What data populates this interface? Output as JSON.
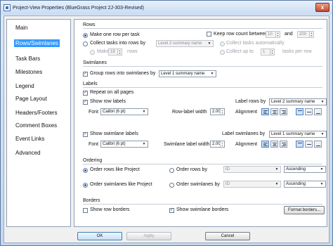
{
  "window": {
    "title": "Project-View Properties (BlueGrass Project 2J-303-Revised)",
    "close_label": "x"
  },
  "nav": {
    "items": [
      "Main",
      "Rows/Swimlanes",
      "Task Bars",
      "Milestones",
      "Legend",
      "Page Layout",
      "Headers/Footers",
      "Comment Boxes",
      "Event Links",
      "Advanced"
    ],
    "selected_index": 1
  },
  "rows": {
    "title": "Rows",
    "one_row_per_task": "Make one row per task",
    "keep_row_count": "Keep row count between",
    "keep_min": "10",
    "and_label": "and",
    "keep_max": "200",
    "collect_tasks_by": "Collect tasks into rows by",
    "collect_tasks_value": "Level 2 summary name",
    "make_label": "Make",
    "make_value": "18",
    "rows_label": "rows",
    "collect_auto": "Collect tasks automatically",
    "collect_up_to": "Collect up to",
    "collect_up_to_value": "1",
    "tasks_per_row": "tasks per row"
  },
  "swimlanes": {
    "title": "Swimlanes",
    "group_rows": "Group rows into swimlanes by",
    "group_value": "Level 1 summary name"
  },
  "labels": {
    "title": "Labels",
    "repeat_all_pages": "Repeat on all pages",
    "show_row_labels": "Show row labels",
    "font_label": "Font",
    "row_font": "Calibri (6 pt)",
    "label_rows_by": "Label rows by",
    "label_rows_value": "Level 2 summary name",
    "row_label_width": "Row-label width",
    "row_label_width_value": "2.00",
    "alignment": "Alignment",
    "show_swimlane_labels": "Show swimlane labels",
    "swimlane_font": "Calibri (6 pt)",
    "label_swimlanes_by": "Label swimlanes by",
    "label_swimlanes_value": "Level 1 summary name",
    "swimlane_label_width": "Swimlane label width",
    "swimlane_label_width_value": "2.00"
  },
  "ordering": {
    "title": "Ordering",
    "order_like_project": "Order rows like Project",
    "order_rows_by": "Order rows by",
    "order_rows_by_value": "ID",
    "order_rows_dir": "Ascending",
    "order_swimlanes_like_project": "Order swimlanes like Project",
    "order_swimlanes_by": "Order swimlanes by",
    "order_swimlanes_by_value": "ID",
    "order_swimlanes_dir": "Ascending"
  },
  "borders": {
    "title": "Borders",
    "show_row_borders": "Show row borders",
    "show_swimlane_borders": "Show swimlane borders",
    "format_borders": "Format borders..."
  },
  "footer": {
    "ok": "OK",
    "apply": "Apply",
    "cancel": "Cancel"
  }
}
